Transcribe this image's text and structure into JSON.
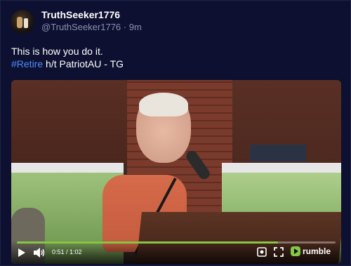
{
  "post": {
    "display_name": "TruthSeeker1776",
    "handle": "@TruthSeeker1776",
    "separator": "·",
    "time_ago": "9m",
    "text_line1": "This is how you do it.",
    "hashtag": "#Retire",
    "text_line2_rest": " h/t PatriotAU - TG"
  },
  "video": {
    "current_time": "0:51",
    "duration": "1:02",
    "time_display": "0:51 / 1:02",
    "progress": 0.82,
    "brand": "rumble",
    "icons": {
      "play": "play-icon",
      "volume": "volume-icon",
      "settings": "gear-icon",
      "fullscreen": "fullscreen-icon",
      "logo": "rumble-logo"
    }
  },
  "colors": {
    "background": "#0d1030",
    "accent_link": "#4f8cff",
    "progress": "#85c742",
    "muted_text": "#8a8fb2"
  }
}
